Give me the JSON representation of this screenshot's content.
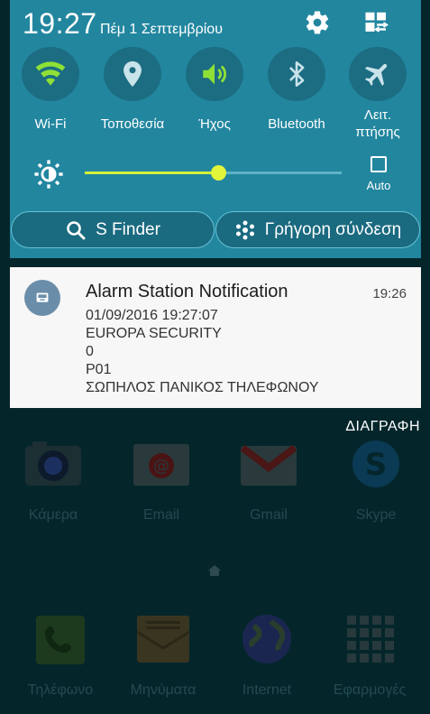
{
  "status": {
    "time": "19:27",
    "date": "Πέμ 1 Σεπτεμβρίου"
  },
  "icons": {
    "settings": "gear-icon",
    "edit": "grid-edit-icon"
  },
  "toggles": [
    {
      "name": "wifi",
      "label": "Wi-Fi",
      "active": true,
      "icon": "wifi-icon"
    },
    {
      "name": "location",
      "label": "Τοποθεσία",
      "active": false,
      "icon": "location-pin-icon"
    },
    {
      "name": "sound",
      "label": "Ήχος",
      "active": true,
      "icon": "speaker-icon"
    },
    {
      "name": "bluetooth",
      "label": "Bluetooth",
      "active": false,
      "icon": "bluetooth-icon"
    },
    {
      "name": "airplane",
      "label": "Λειτ.\nπτήσης",
      "label_line1": "Λειτ.",
      "label_line2": "πτήσης",
      "active": false,
      "icon": "airplane-icon"
    }
  ],
  "brightness": {
    "level": 0.52,
    "auto_label": "Auto",
    "auto_checked": false
  },
  "pills": {
    "finder": "S Finder",
    "quick_connect": "Γρήγορη σύνδεση"
  },
  "notification": {
    "title": "Alarm Station Notification",
    "time": "19:26",
    "lines": [
      "01/09/2016 19:27:07",
      "EUROPA SECURITY",
      "0",
      "P01",
      "ΣΩΠΗΛΟΣ ΠΑΝΙΚΟΣ ΤΗΛΕΦΩΝΟΥ"
    ]
  },
  "clear_label": "ΔΙΑΓΡΑΦΗ",
  "home_apps_row1": [
    "Κάμερα",
    "Email",
    "Gmail",
    "Skype"
  ],
  "home_apps_row2": [
    "Τηλέφωνο",
    "Μηνύματα",
    "Internet",
    "Εφαρμογές"
  ],
  "colors": {
    "panel": "#22869f",
    "accent": "#8fe036",
    "slider": "#d6f23a",
    "card": "#f7f7f7"
  }
}
